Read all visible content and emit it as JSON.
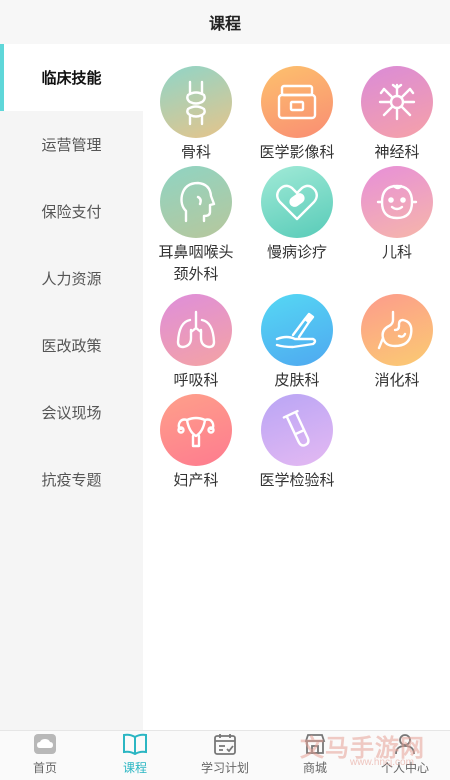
{
  "header": {
    "title": "课程"
  },
  "sidebar": {
    "items": [
      {
        "label": "临床技能",
        "active": true
      },
      {
        "label": "运营管理"
      },
      {
        "label": "保险支付"
      },
      {
        "label": "人力资源"
      },
      {
        "label": "医改政策"
      },
      {
        "label": "会议现场"
      },
      {
        "label": "抗疫专题"
      }
    ]
  },
  "categories": [
    {
      "label": "骨科",
      "icon": "bone-joint-icon",
      "colors": [
        "#8fd5c8",
        "#e6c48a"
      ]
    },
    {
      "label": "医学影像科",
      "icon": "imaging-machine-icon",
      "colors": [
        "#fdc16d",
        "#f98d73"
      ]
    },
    {
      "label": "神经科",
      "icon": "neuron-icon",
      "colors": [
        "#da8bd8",
        "#f6a1a8"
      ]
    },
    {
      "label": "耳鼻咽喉头",
      "label2": "颈外科",
      "icon": "head-profile-icon",
      "colors": [
        "#8fd4c3",
        "#b7c79c"
      ]
    },
    {
      "label": "慢病诊疗",
      "icon": "heart-pill-icon",
      "colors": [
        "#a1ead7",
        "#58cbb8"
      ]
    },
    {
      "label": "儿科",
      "icon": "baby-face-icon",
      "colors": [
        "#e78fd9",
        "#f6b6a9"
      ]
    },
    {
      "label": "呼吸科",
      "icon": "lungs-icon",
      "colors": [
        "#de8edb",
        "#f4a3a3"
      ]
    },
    {
      "label": "皮肤科",
      "icon": "skin-care-icon",
      "colors": [
        "#55d8f4",
        "#4fa8f0"
      ]
    },
    {
      "label": "消化科",
      "icon": "stomach-icon",
      "colors": [
        "#fc9b8c",
        "#fbcb72"
      ]
    },
    {
      "label": "妇产科",
      "icon": "uterus-icon",
      "colors": [
        "#fea08a",
        "#fe7b8f"
      ]
    },
    {
      "label": "医学检验科",
      "icon": "test-tube-icon",
      "colors": [
        "#b9a5f5",
        "#e4b9f2"
      ]
    }
  ],
  "tabbar": {
    "items": [
      {
        "label": "首页",
        "icon": "home-cloud-icon"
      },
      {
        "label": "课程",
        "icon": "open-book-icon",
        "active": true
      },
      {
        "label": "学习计划",
        "icon": "calendar-plan-icon"
      },
      {
        "label": "商城",
        "icon": "shop-icon"
      },
      {
        "label": "个人中心",
        "icon": "person-icon"
      }
    ]
  },
  "watermark": {
    "text": "文马手游网",
    "url": "www.hncj.com"
  },
  "colors": {
    "accent": "#5fd7d9",
    "tab_active": "#2bb6c3"
  }
}
